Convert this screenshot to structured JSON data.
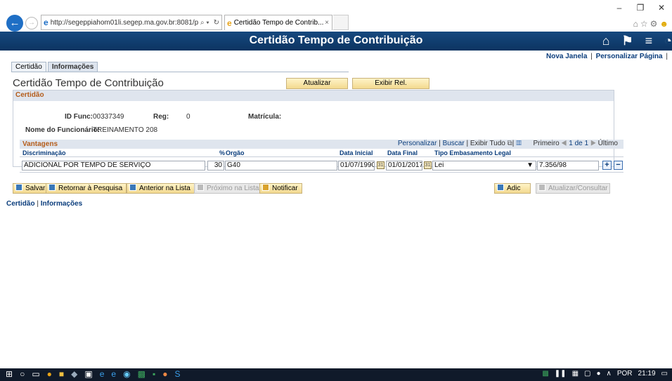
{
  "browser": {
    "url": "http://segeppiahom01li.segep.ma.gov.br:8081/psp/hr",
    "search_glyph": "⌕ ▾",
    "refresh_glyph": "↻",
    "tab_title": "Certidão Tempo de Contrib...",
    "tab_close": "×",
    "window_controls": [
      "–",
      "❐",
      "✕"
    ],
    "toolbar_icons": [
      "home-icon",
      "star-icon",
      "gear-icon",
      "smiley-icon"
    ]
  },
  "header": {
    "title": "Certidão Tempo de Contribuição",
    "icons": [
      "home-icon",
      "flag-icon",
      "menu-icon",
      "navbar-icon"
    ]
  },
  "top_links": {
    "new_window": "Nova Janela",
    "separator": "|",
    "personalize": "Personalizar Página",
    "trailing_sep": "|"
  },
  "page_tabs": [
    {
      "label": "Certidão",
      "active": false
    },
    {
      "label": "Informações",
      "active": true
    }
  ],
  "page_title": "Certidão Tempo de Contribuição",
  "buttons": {
    "atualizar": "Atualizar",
    "exibir_rel": "Exibir Rel."
  },
  "certidao": {
    "section_title": "Certidão",
    "id_func_label": "ID Func:",
    "id_func_value": "00337349",
    "reg_label": "Reg:",
    "reg_value": "0",
    "matricula_label": "Matrícula:",
    "nome_label": "Nome do Funcionário:",
    "nome_value": "TREINAMENTO 208"
  },
  "vantagens": {
    "title": "Vantagens",
    "personalizar": "Personalizar",
    "buscar": "Buscar",
    "exibir_tudo": "Exibir Tudo",
    "primeiro": "Primeiro",
    "range": "1 de 1",
    "ultimo": "Último",
    "columns": {
      "discriminacao": "Discriminação",
      "percent": "%",
      "orgao": "Orgão",
      "data_inicial": "Data Inicial",
      "data_final": "Data Final",
      "tipo": "Tipo Embasamento Legal"
    },
    "rows": [
      {
        "discriminacao": "ADICIONAL POR TEMPO DE SERVIÇO",
        "percent": "30",
        "orgao": "G40",
        "data_inicial": "01/07/1990",
        "data_final": "01/01/2017",
        "tipo": "Lei",
        "lei_numero": "7.356/98"
      }
    ],
    "add_row": "+",
    "remove_row": "−"
  },
  "toolbar": {
    "salvar": "Salvar",
    "retornar": "Retornar à Pesquisa",
    "anterior": "Anterior na Lista",
    "proximo": "Próximo na Lista",
    "notificar": "Notificar",
    "adic": "Adic",
    "atualizar_consultar": "Atualizar/Consultar"
  },
  "bottom_links": {
    "certidao": "Certidão",
    "separator": "|",
    "informacoes": "Informações"
  },
  "taskbar": {
    "language": "POR",
    "time": "21:19",
    "apps": [
      "start-icon",
      "search-icon",
      "task-view-icon",
      "chrome-icon",
      "file-explorer-icon",
      "app-icon",
      "store-icon",
      "ie-icon",
      "edge-icon",
      "app2-icon",
      "excel-icon",
      "app3-icon",
      "chrome2-icon",
      "skype-icon"
    ]
  },
  "colors": {
    "header_bg": "#0c3461",
    "link": "#0a3d7c",
    "section_title": "#b45c1a",
    "button_bg": "#f3d98f"
  }
}
